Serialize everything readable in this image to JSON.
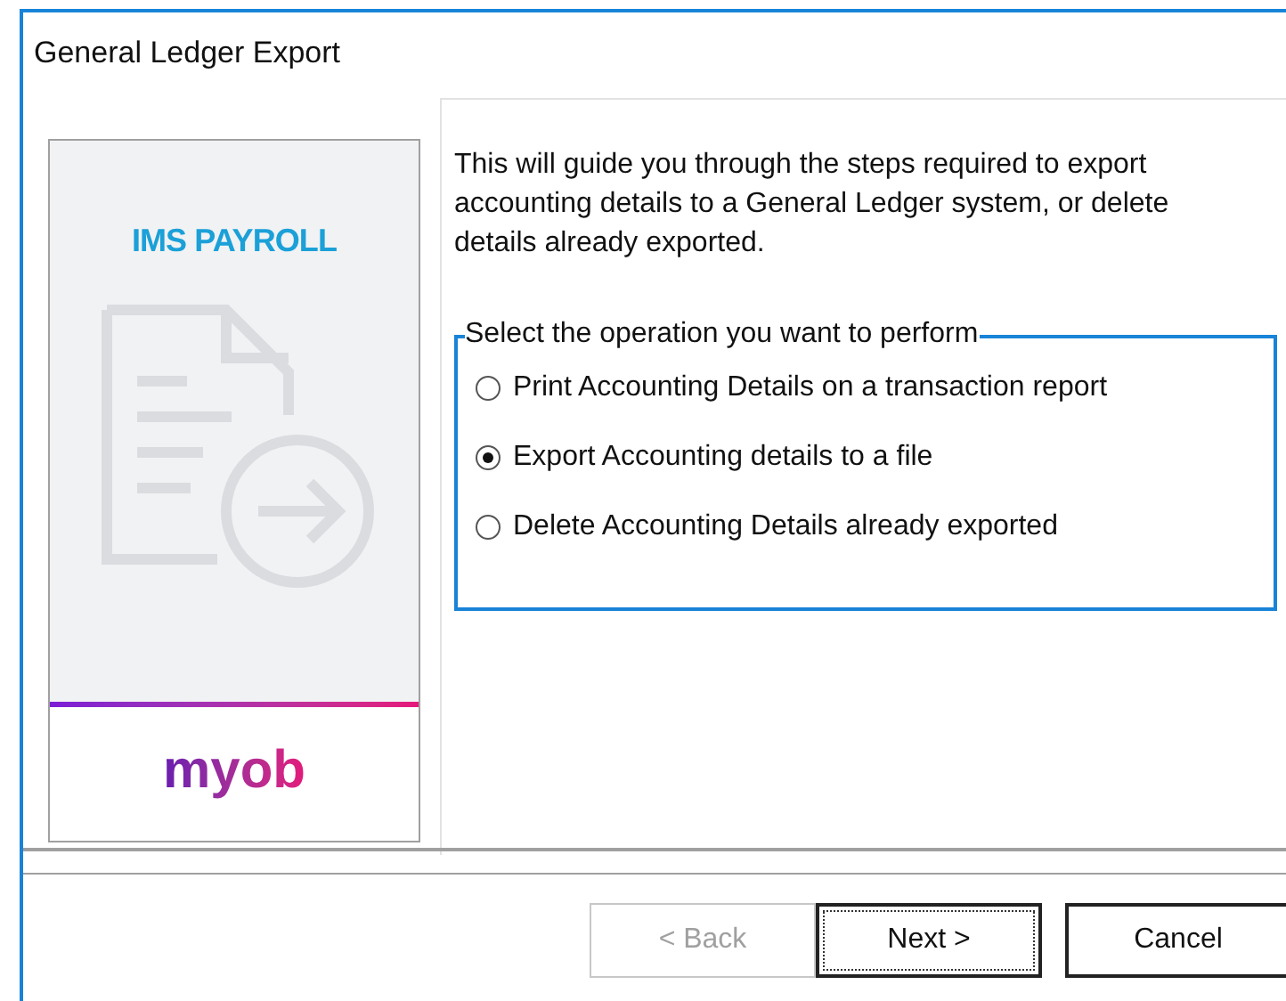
{
  "window": {
    "title": "General Ledger Export"
  },
  "banner": {
    "product": "IMS PAYROLL",
    "brand": "myob"
  },
  "intro": "This will guide you through the steps required to export accounting details to a General Ledger system, or delete details already exported.",
  "operation_group": {
    "label": "Select the operation you want to perform",
    "options": [
      {
        "label": "Print Accounting Details on a transaction report",
        "selected": false
      },
      {
        "label": "Export Accounting details to a file",
        "selected": true
      },
      {
        "label": "Delete Accounting Details already exported",
        "selected": false
      }
    ]
  },
  "buttons": [
    {
      "label": "< Back",
      "disabled": true,
      "default": false
    },
    {
      "label": "Next >",
      "disabled": false,
      "default": true
    },
    {
      "label": "Cancel",
      "disabled": false,
      "default": false
    }
  ]
}
